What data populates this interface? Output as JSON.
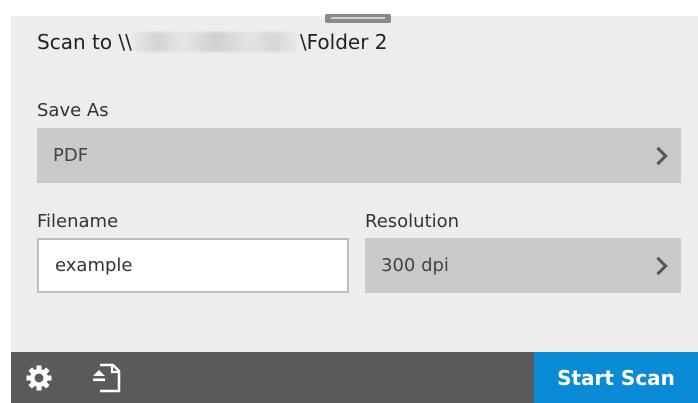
{
  "header": {
    "title_prefix": "Scan to \\\\",
    "title_suffix": "\\Folder 2"
  },
  "save_as": {
    "label": "Save As",
    "value": "PDF"
  },
  "filename": {
    "label": "Filename",
    "value": "example"
  },
  "resolution": {
    "label": "Resolution",
    "value": "300 dpi"
  },
  "footer": {
    "start_label": "Start Scan",
    "accent_color": "#0b8ad6",
    "icons": [
      "gear-icon",
      "document-eject-icon"
    ]
  }
}
